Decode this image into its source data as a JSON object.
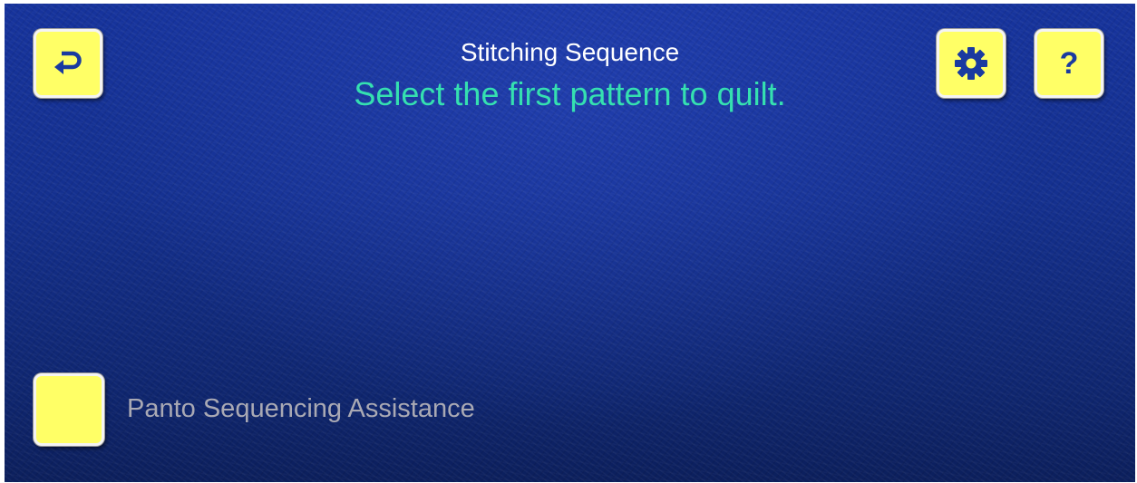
{
  "header": {
    "title": "Stitching Sequence",
    "instruction": "Select the first pattern to quilt."
  },
  "toolbar": {
    "back_icon": "return-arrow-icon",
    "settings_icon": "gear-icon",
    "help_glyph": "?"
  },
  "options": {
    "panto_sequencing_label": "Panto Sequencing Assistance",
    "panto_sequencing_checked": false
  },
  "colors": {
    "button_fill": "#ffff66",
    "icon_blue": "#1a3aa0",
    "instruction_text": "#35e0b0",
    "title_text": "#ffffff",
    "label_text": "#a9a9b4",
    "background": "#14308f"
  }
}
